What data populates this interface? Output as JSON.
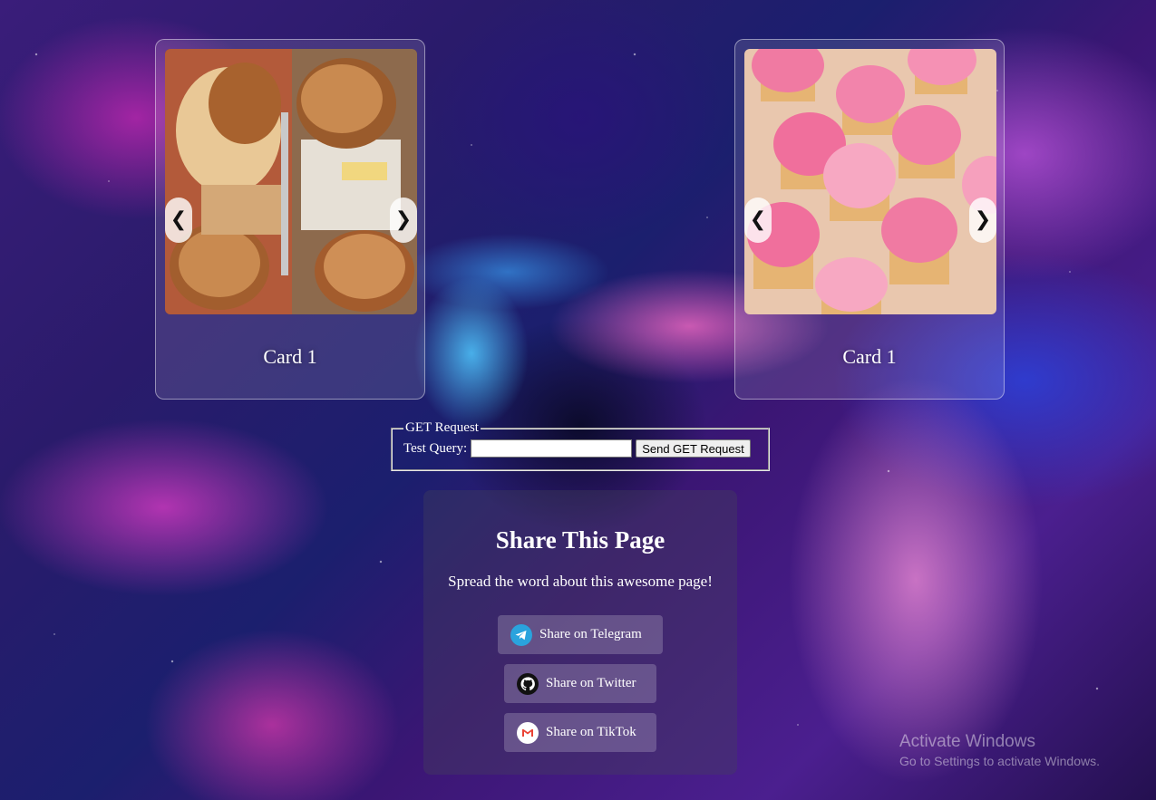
{
  "cards": [
    {
      "title": "Card 1",
      "prev_icon": "❮",
      "next_icon": "❯",
      "image": "bread-loaves-photo"
    },
    {
      "title": "Card 1",
      "prev_icon": "❮",
      "next_icon": "❯",
      "image": "pink-cupcakes-photo"
    }
  ],
  "get_request": {
    "legend": "GET Request",
    "label": "Test Query:",
    "input_value": "",
    "button_label": "Send GET Request"
  },
  "share": {
    "title": "Share This Page",
    "subtitle": "Spread the word about this awesome page!",
    "buttons": [
      {
        "label": "Share on Telegram",
        "icon": "telegram-icon"
      },
      {
        "label": "Share on Twitter",
        "icon": "github-icon"
      },
      {
        "label": "Share on TikTok",
        "icon": "gmail-icon"
      }
    ]
  },
  "watermark": {
    "title": "Activate Windows",
    "subtitle": "Go to Settings to activate Windows."
  },
  "colors": {
    "telegram": "#2aa3dd",
    "gmail_red": "#ea4335"
  }
}
